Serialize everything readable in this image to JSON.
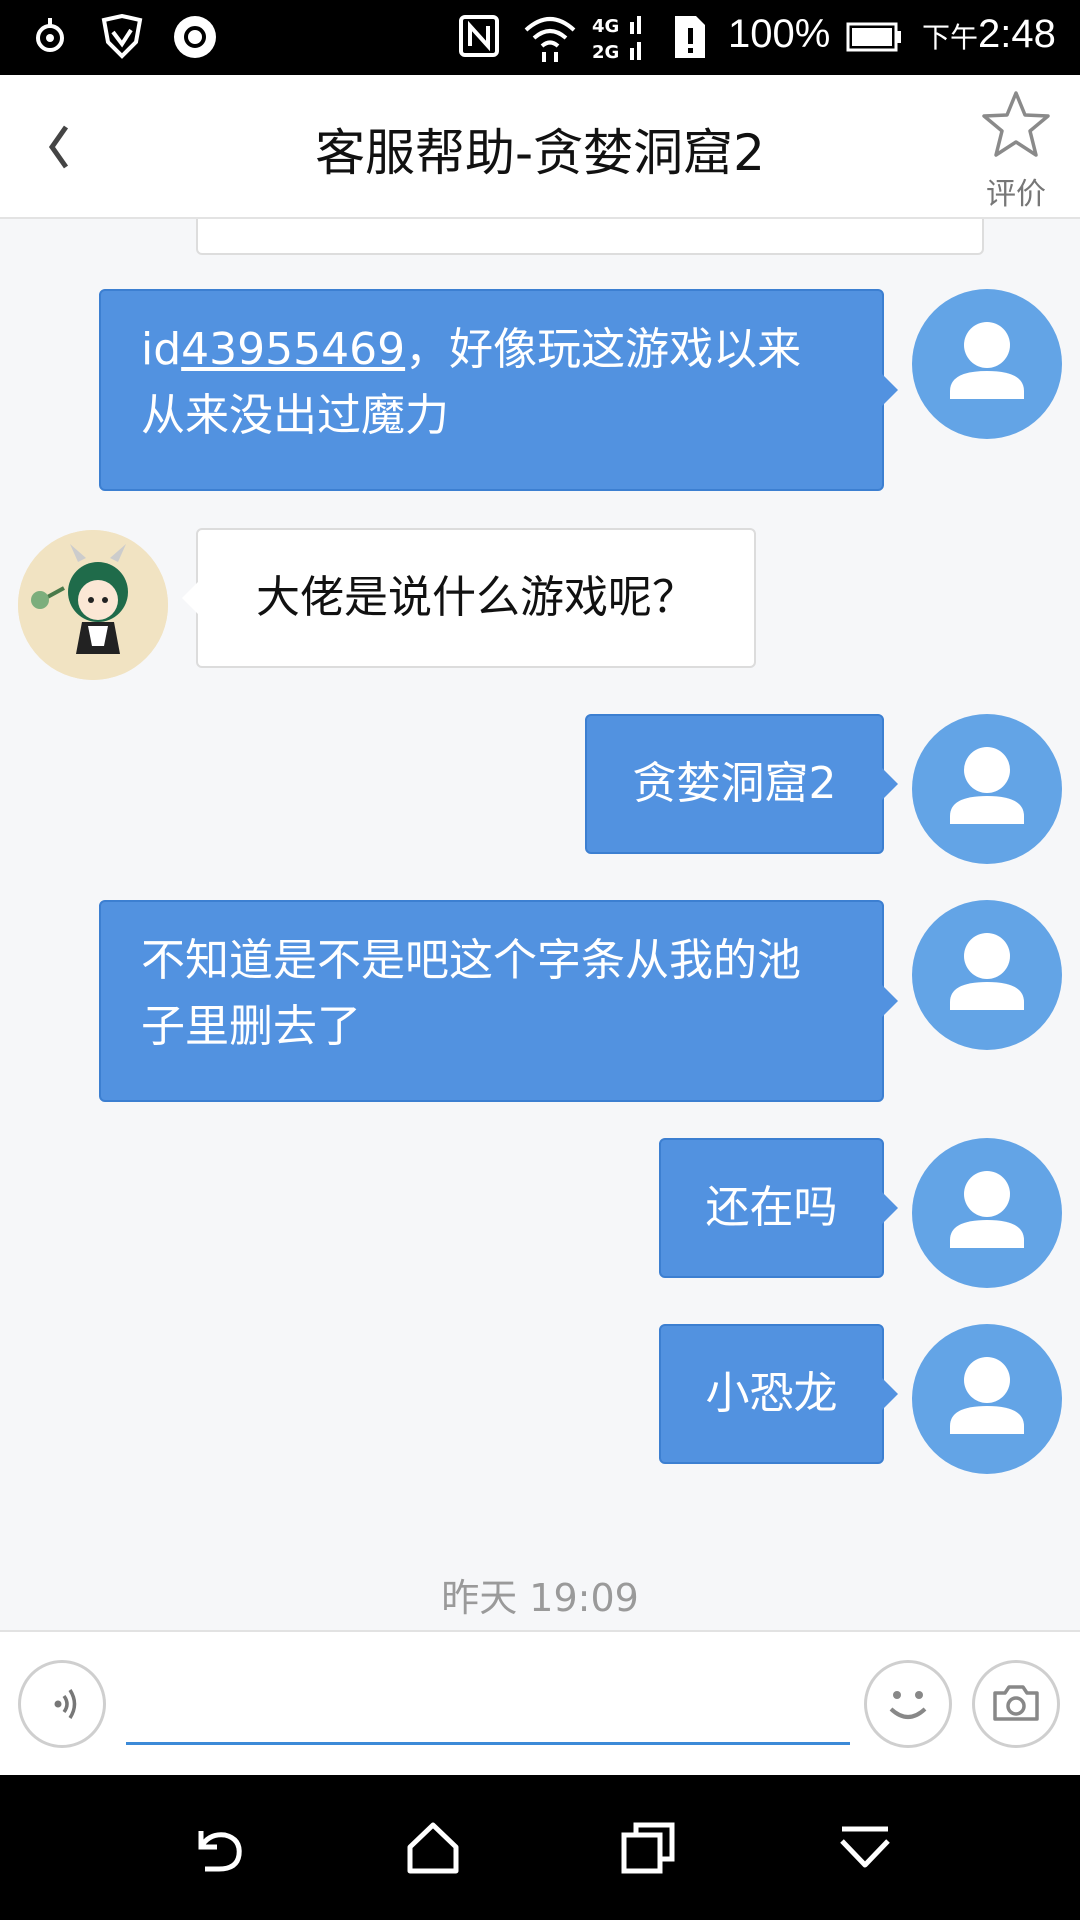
{
  "status_bar": {
    "battery": "100%",
    "ampm": "下午",
    "time": "2:48",
    "net_4g": "4G",
    "net_2g": "2G"
  },
  "header": {
    "title": "客服帮助-贪婪洞窟2",
    "rate_label": "评价"
  },
  "messages": [
    {
      "from": "me",
      "prefix": "id",
      "uid": "43955469",
      "text": "，好像玩这游戏以来从来没出过魔力"
    },
    {
      "from": "cs",
      "text": "大佬是说什么游戏呢？"
    },
    {
      "from": "me",
      "text": "贪婪洞窟2"
    },
    {
      "from": "me",
      "text": "不知道是不是吧这个字条从我的池子里删去了"
    },
    {
      "from": "me",
      "text": "还在吗"
    },
    {
      "from": "me",
      "text": "小恐龙"
    }
  ],
  "timestamp": "昨天 19:09",
  "input": {
    "placeholder": ""
  },
  "colors": {
    "bubble_out": "#5292e0",
    "avatar_me": "#63a4e6",
    "input_underline": "#3c8ad8"
  },
  "icons": {
    "back": "chevron-left-icon",
    "rate": "star-outline-icon",
    "voice": "voice-icon",
    "emoji": "smiley-icon",
    "camera": "camera-icon",
    "nav_back": "nav-back-icon",
    "nav_home": "nav-home-icon",
    "nav_recents": "nav-recents-icon",
    "nav_hide": "nav-hide-keyboard-icon"
  }
}
